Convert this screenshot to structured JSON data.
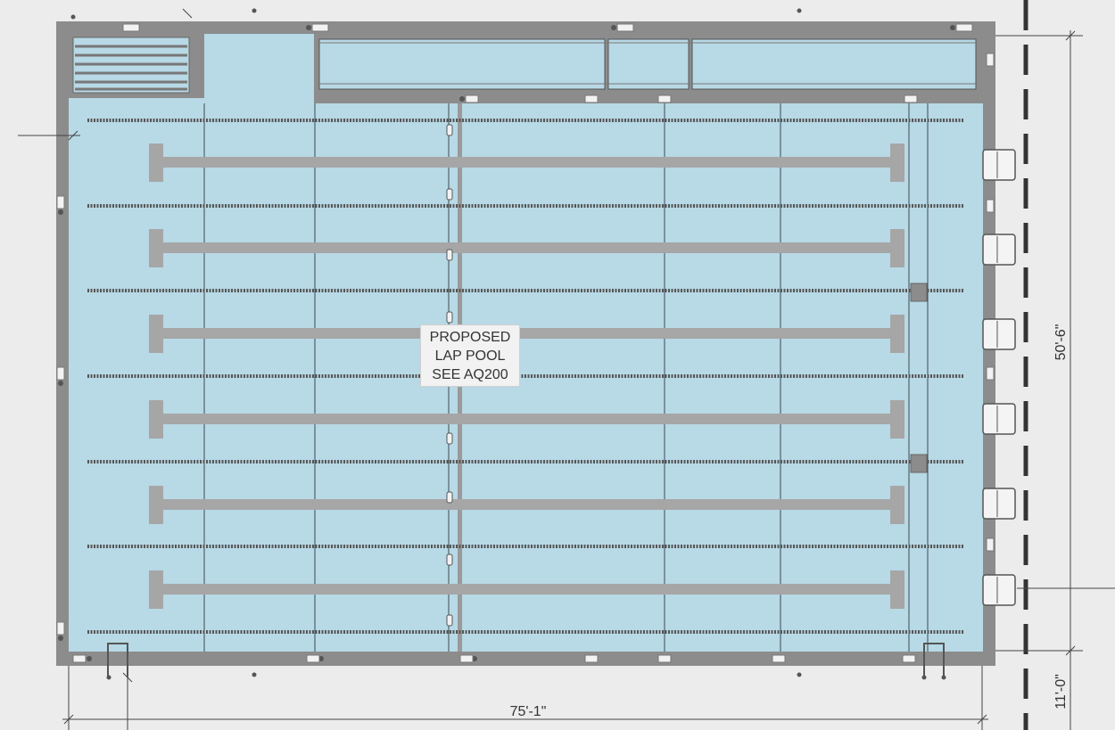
{
  "pool_label": {
    "line1": "PROPOSED",
    "line2": "LAP POOL",
    "line3": "SEE AQ200"
  },
  "dimensions": {
    "width": "75'-1\"",
    "length": "50'-6\"",
    "offset": "11'-0\""
  },
  "lanes": {
    "count": 6,
    "lane_lines": 7,
    "starting_blocks": 6
  },
  "colors": {
    "water": "#b8d9e6",
    "deck": "#8c8c8c",
    "lane_marking": "#a6a6a6",
    "background": "#ececec"
  }
}
